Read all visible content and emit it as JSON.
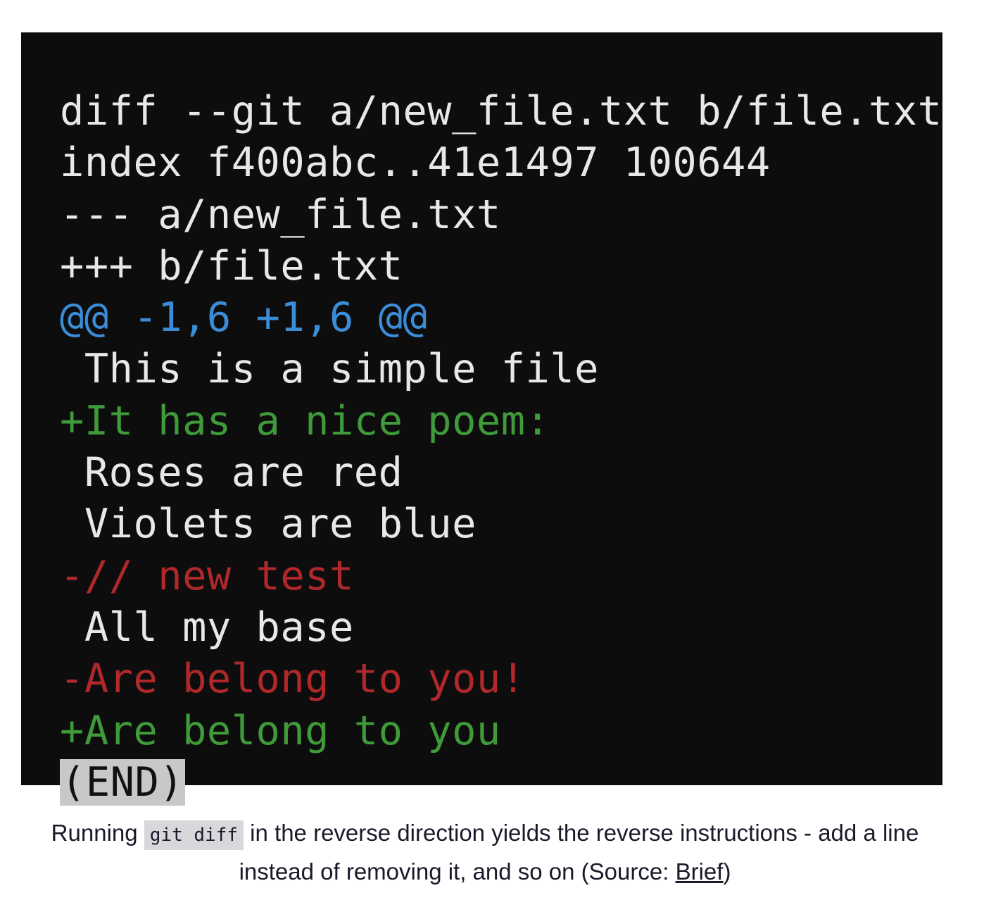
{
  "terminal": {
    "lines": [
      {
        "text": "diff --git a/new_file.txt b/file.txt",
        "kind": "header"
      },
      {
        "text": "index f400abc..41e1497 100644",
        "kind": "header"
      },
      {
        "text": "--- a/new_file.txt",
        "kind": "header"
      },
      {
        "text": "+++ b/file.txt",
        "kind": "header"
      },
      {
        "text": "@@ -1,6 +1,6 @@",
        "kind": "hunk"
      },
      {
        "text": " This is a simple file",
        "kind": "context"
      },
      {
        "text": "+It has a nice poem:",
        "kind": "add"
      },
      {
        "text": " Roses are red",
        "kind": "context"
      },
      {
        "text": " Violets are blue",
        "kind": "context"
      },
      {
        "text": "-// new test",
        "kind": "del"
      },
      {
        "text": " All my base",
        "kind": "context"
      },
      {
        "text": "-Are belong to you!",
        "kind": "del"
      },
      {
        "text": "+Are belong to you",
        "kind": "add"
      }
    ],
    "end_marker": "(END)"
  },
  "caption": {
    "before": "Running ",
    "code": "git diff",
    "after": " in the reverse direction yields the reverse instructions - add a line instead of removing it, and so on (Source: ",
    "link": "Brief",
    "close": ")"
  }
}
